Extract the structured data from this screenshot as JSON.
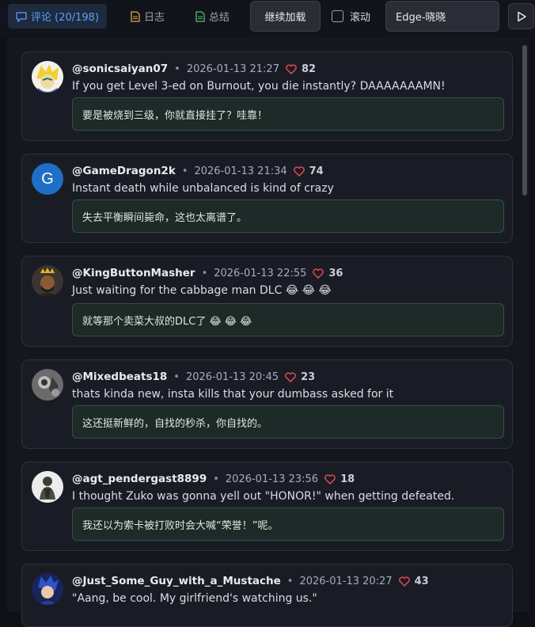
{
  "toolbar": {
    "tabs": [
      {
        "label": "评论 (20/198)",
        "icon": "chat-bubble-icon",
        "active": true
      },
      {
        "label": "日志",
        "icon": "log-file-icon",
        "active": false
      },
      {
        "label": "总结",
        "icon": "summary-file-icon",
        "active": false
      }
    ],
    "load_more_label": "继续加载",
    "scroll_label": "滚动",
    "scroll_checked": false,
    "voice_value": "Edge-晓晓",
    "play_icon": "play-icon"
  },
  "colors": {
    "accent": "#5aa0ff",
    "heart": "#e5484d",
    "log_icon": "#e8a23a",
    "summary_icon": "#4cc26a",
    "translation_border": "#355246"
  },
  "comments": [
    {
      "author": "@sonicsaiyan07",
      "time": "2026-01-13 21:27",
      "likes": "82",
      "text": "If you get Level 3-ed on Burnout, you die instantly? DAAAAAAAMN!",
      "translation": "要是被烧到三级，你就直接挂了？哇靠！"
    },
    {
      "author": "@GameDragon2k",
      "time": "2026-01-13 21:34",
      "likes": "74",
      "text": "Instant death while unbalanced is kind of crazy",
      "translation": "失去平衡瞬间毙命，这也太离谱了。",
      "avatar_letter": "G"
    },
    {
      "author": "@KingButtonMasher",
      "time": "2026-01-13 22:55",
      "likes": "36",
      "text": "Just waiting for the cabbage man DLC 😂 😂 😂",
      "translation": "就等那个卖菜大叔的DLC了 😂 😂 😂"
    },
    {
      "author": "@Mixedbeats18",
      "time": "2026-01-13 20:45",
      "likes": "23",
      "text": "thats kinda new, insta kills that your dumbass asked for it",
      "translation": "这还挺新鲜的，自找的秒杀，你自找的。"
    },
    {
      "author": "@agt_pendergast8899",
      "time": "2026-01-13 23:56",
      "likes": "18",
      "text": "I thought Zuko was gonna yell out \"HONOR!\" when getting defeated.",
      "translation": "我还以为索卡被打败时会大喊“荣誉！”呢。"
    },
    {
      "author": "@Just_Some_Guy_with_a_Mustache",
      "time": "2026-01-13 20:27",
      "likes": "43",
      "text": "\"Aang, be cool. My girlfriend's watching us.\"",
      "translation": ""
    }
  ]
}
